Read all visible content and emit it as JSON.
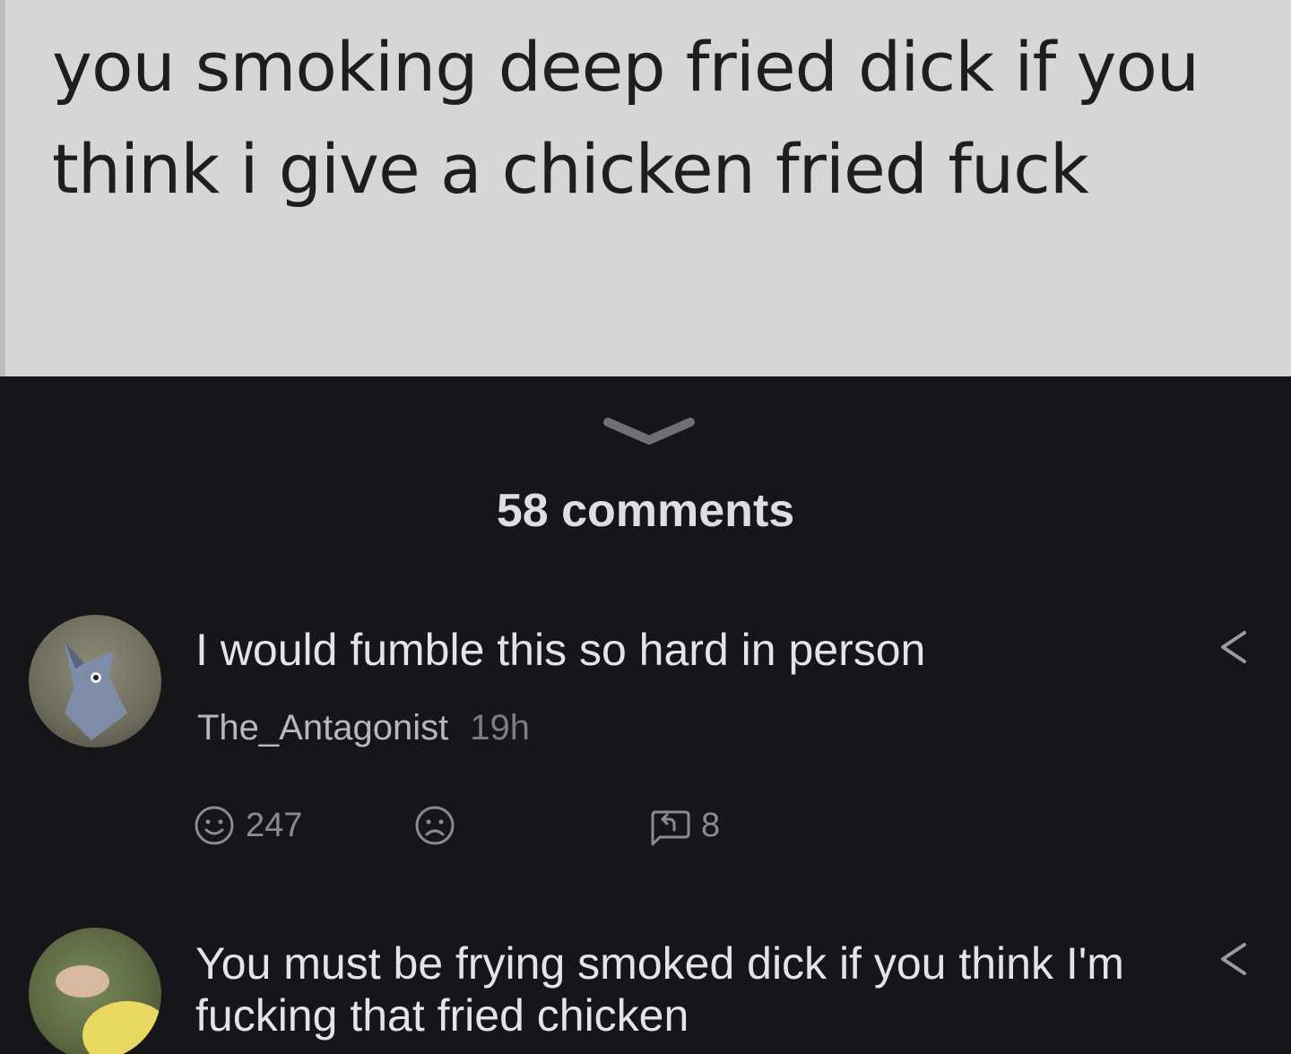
{
  "post": {
    "text": "you smoking deep fried dick if you think i give a chicken fried fuck"
  },
  "comments_header": {
    "count_label": "58 comments"
  },
  "comments": [
    {
      "text": "I would fumble this so hard in person",
      "author": "The_Antagonist",
      "time": "19h",
      "likes": "247",
      "replies": "8"
    },
    {
      "text": "You must be frying smoked dick if you think I'm fucking that fried chicken"
    }
  ],
  "icons": {
    "collapse": "chevron-down-icon",
    "share": "share-icon",
    "like": "smile-icon",
    "dislike": "frown-icon",
    "reply": "reply-icon"
  },
  "colors": {
    "post_background": "#d6d6d8",
    "dark_background": "#16151a",
    "primary_text": "#e4e4e8",
    "muted_text": "#8a8a90"
  }
}
